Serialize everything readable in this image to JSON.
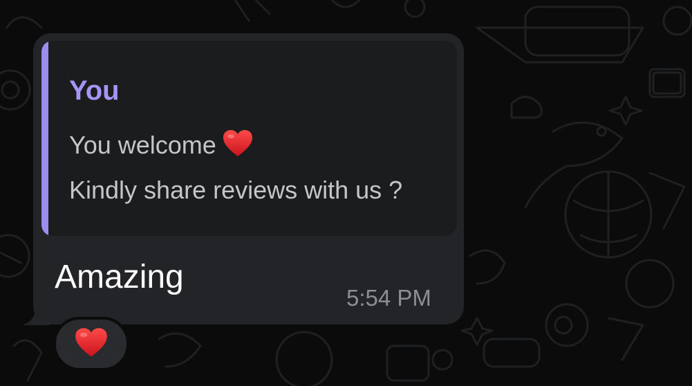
{
  "quoted_message": {
    "author": "You",
    "line1": "You welcome",
    "line2": "Kindly share reviews with us ?"
  },
  "message": {
    "text": "Amazing",
    "time": "5:54 PM"
  },
  "reaction": {
    "emoji_icon": "red-heart-icon"
  },
  "colors": {
    "background": "#0b0b0c",
    "bubble": "#232427",
    "quote_background": "#1b1c1e",
    "quote_accent": "#9b8cf2",
    "author_text": "#a694f7",
    "reaction_background": "#2a2b2e"
  }
}
